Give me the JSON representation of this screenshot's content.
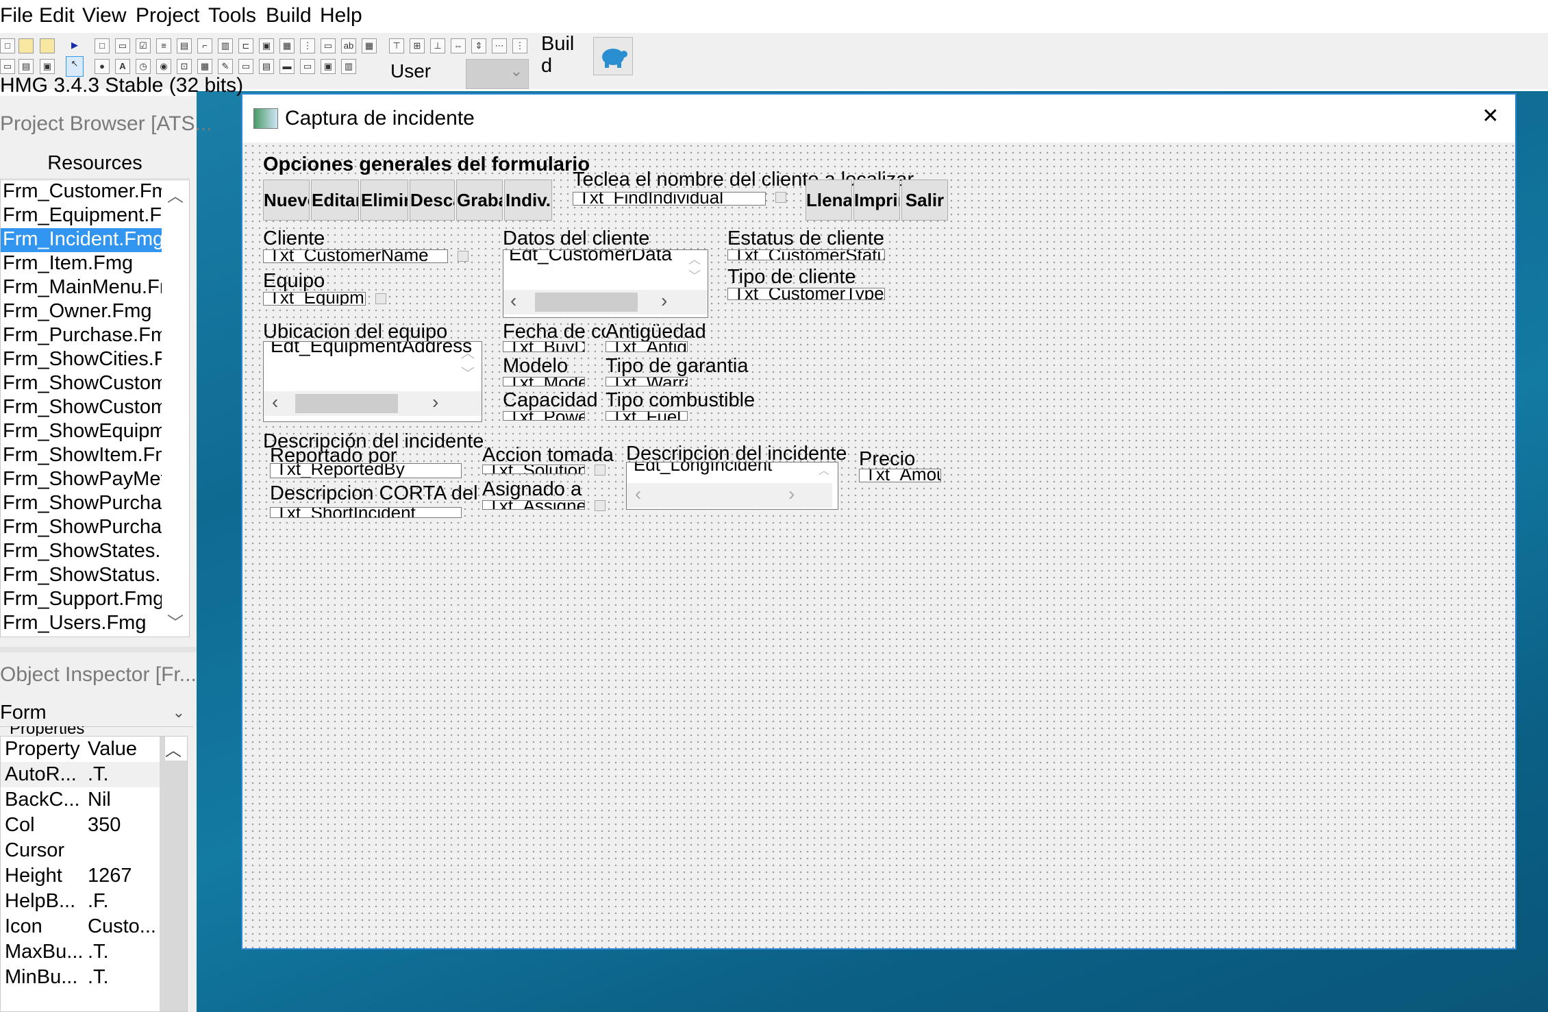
{
  "menu": [
    "File",
    "Edit",
    "View",
    "Project",
    "Tools",
    "Build",
    "Help"
  ],
  "toolbar": {
    "build_label": "Build",
    "user_label": "User"
  },
  "status_text": "HMG 3.4.3 Stable (32 bits)",
  "project_browser": {
    "title": "Project Browser [ATS...",
    "header": "Resources",
    "items": [
      "Frm_Customer.Fmg",
      "Frm_Equipment.Fmg",
      "Frm_Incident.Fmg",
      "Frm_Item.Fmg",
      "Frm_MainMenu.Fmg",
      "Frm_Owner.Fmg",
      "Frm_Purchase.Fmg",
      "Frm_ShowCities.Fmg",
      "Frm_ShowCustomer.Fmg",
      "Frm_ShowCustomer.Fmg",
      "Frm_ShowEquipment.Fmg",
      "Frm_ShowItem.Fmg",
      "Frm_ShowPayMethod.Fmg",
      "Frm_ShowPurchase.Fmg",
      "Frm_ShowPurchase.Fmg",
      "Frm_ShowStates.Fmg",
      "Frm_ShowStatus.Fmg",
      "Frm_Support.Fmg",
      "Frm_Users.Fmg"
    ]
  },
  "object_inspector": {
    "title": "Object Inspector [Fr...",
    "selector": "Form",
    "tabs_label": "Properties",
    "col_property": "Property",
    "col_value": "Value",
    "rows": [
      {
        "p": "AutoR...",
        "v": ".T."
      },
      {
        "p": "BackC...",
        "v": "Nil"
      },
      {
        "p": "Col",
        "v": "350"
      },
      {
        "p": "Cursor",
        "v": ""
      },
      {
        "p": "Height",
        "v": "1267"
      },
      {
        "p": "HelpB...",
        "v": ".F."
      },
      {
        "p": "Icon",
        "v": "Custo..."
      },
      {
        "p": "MaxBu...",
        "v": ".T."
      },
      {
        "p": "MinBu...",
        "v": ".T."
      }
    ]
  },
  "form": {
    "title": "Captura de incidente",
    "close": "✕",
    "lbl_opciones": "Opciones generales del formulario",
    "buttons": [
      "Nuevo",
      "Editar",
      "Eliminar",
      "Descartar",
      "Grabar",
      "Indiv."
    ],
    "lbl_teclea": "Teclea el nombre del cliente a localizar",
    "txt_find": "Txt_FindIndividual",
    "buttons_right": [
      "Llenar",
      "Imprimir",
      "Salir"
    ],
    "lbl_cliente": "Cliente",
    "txt_customer": "Txt_CustomerName",
    "lbl_datos": "Datos del cliente",
    "edt_customer": "Edt_CustomerData",
    "lbl_estatus": "Estatus de cliente",
    "txt_status": "Txt_CustomerStatus",
    "lbl_equipo": "Equipo",
    "txt_equip": "Txt_Equipment",
    "lbl_tipo_cliente": "Tipo de cliente",
    "txt_custtype": "Txt_CustomerType",
    "lbl_ubicacion": "Ubicacion del equipo",
    "edt_equipment": "Edt_EquipmentAddress",
    "lbl_fecha": "Fecha de compra",
    "txt_fecha": "Txt_BuyDate",
    "lbl_antiguedad": "Antigüedad",
    "txt_antig": "Txt_Antiquity",
    "lbl_modelo": "Modelo",
    "txt_modelo": "Txt_Model",
    "lbl_garantia": "Tipo de garantia",
    "txt_garantia": "Txt_Warranty",
    "lbl_capacidad": "Capacidad",
    "txt_capacidad": "Txt_Power",
    "lbl_combustible": "Tipo combustible",
    "txt_combustible": "Txt_Fuel",
    "lbl_descripcion": "Descripción del incidente",
    "lbl_reportado": "Reportado por",
    "txt_reportado": "Txt_ReportedBy",
    "lbl_accion": "Accion tomada",
    "txt_accion": "Txt_Solution",
    "lbl_desc_inc": "Descripcion del incidente",
    "edt_desc": "Edt_LongIncident",
    "lbl_precio": "Precio",
    "txt_precio": "Txt_Amount",
    "lbl_desc_corta": "Descripcion CORTA del incidente",
    "txt_corta": "Txt_ShortIncident",
    "lbl_asignado": "Asignado a",
    "txt_asignado": "Txt_Assigned"
  },
  "colors": {
    "selection": "#3296f0",
    "window_border": "#2f86d6",
    "desktop": "#137aa2"
  }
}
